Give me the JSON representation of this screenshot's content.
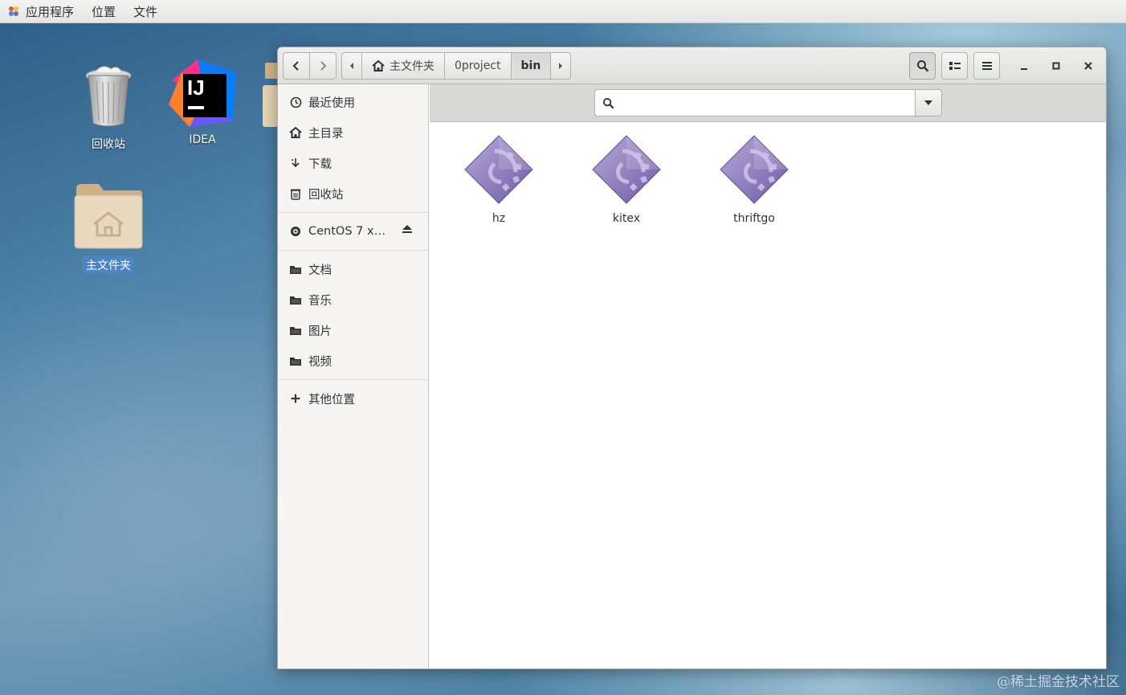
{
  "topbar": {
    "menus": [
      "应用程序",
      "位置",
      "文件"
    ]
  },
  "desktop": {
    "icons": [
      {
        "label": "回收站",
        "icon": "trash-icon"
      },
      {
        "label": "IDEA",
        "icon": "intellij-idea-icon"
      },
      {
        "label": "主文件夹",
        "icon": "home-folder-icon",
        "selected": true
      }
    ]
  },
  "window": {
    "pathbar": {
      "segments": [
        "主文件夹",
        "0project",
        "bin"
      ],
      "current": "bin"
    },
    "sidebar": {
      "places": [
        {
          "label": "最近使用",
          "icon": "clock-icon"
        },
        {
          "label": "主目录",
          "icon": "home-icon"
        },
        {
          "label": "下载",
          "icon": "download-icon"
        },
        {
          "label": "回收站",
          "icon": "trash-icon"
        }
      ],
      "devices": [
        {
          "label": "CentOS 7 x…",
          "icon": "disc-icon"
        }
      ],
      "bookmarks": [
        {
          "label": "文档",
          "icon": "folder-icon"
        },
        {
          "label": "音乐",
          "icon": "folder-icon"
        },
        {
          "label": "图片",
          "icon": "folder-icon"
        },
        {
          "label": "视频",
          "icon": "folder-icon"
        }
      ],
      "other": {
        "label": "其他位置",
        "icon": "plus-icon"
      }
    },
    "search": {
      "placeholder": "",
      "value": ""
    },
    "files": [
      {
        "name": "hz",
        "icon": "executable-icon"
      },
      {
        "name": "kitex",
        "icon": "executable-icon"
      },
      {
        "name": "thriftgo",
        "icon": "executable-icon"
      }
    ]
  },
  "watermark": "@稀土掘金技术社区",
  "colors": {
    "selection": "#4a86c6",
    "executable_icon": "#9b86c4"
  }
}
